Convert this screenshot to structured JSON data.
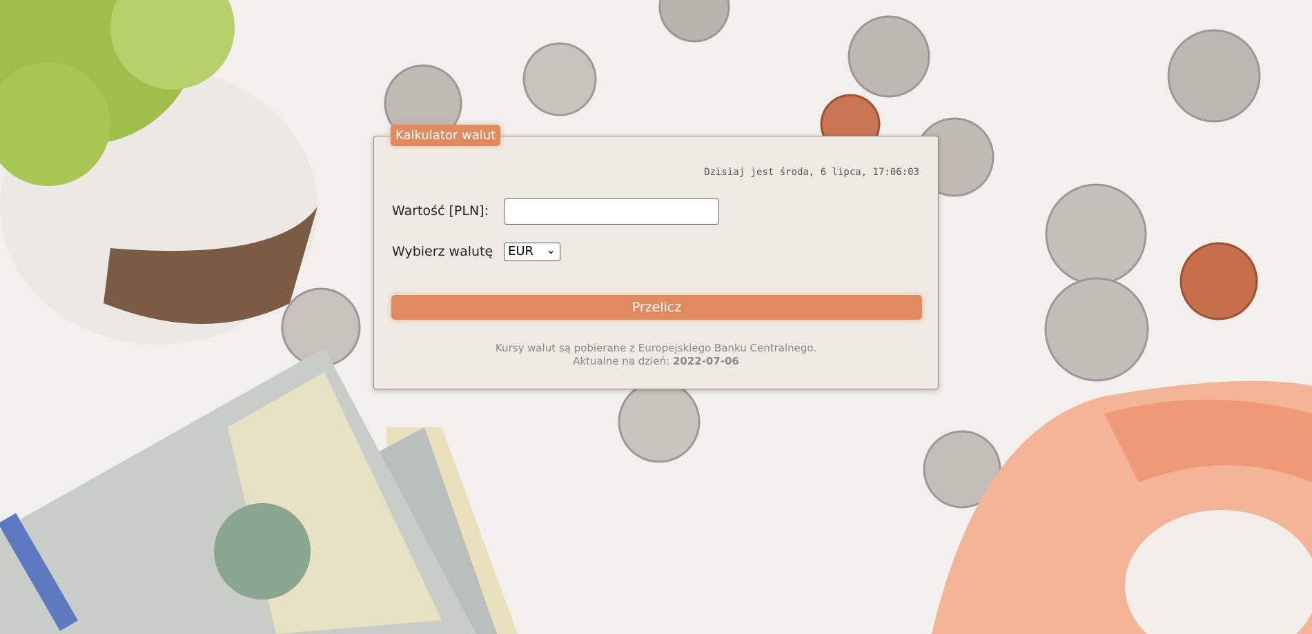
{
  "calculator": {
    "legend": "Kalkulator walut",
    "date_text": "Dzisiaj jest środa, 6 lipca, 17:06:03",
    "value_label": "Wartość [PLN]:",
    "value_input": "",
    "currency_label": "Wybierz walutę",
    "currency_selected": "EUR",
    "convert_button": "Przelicz",
    "info_line1": "Kursy walut są pobierane z Europejskiego Banku Centralnego.",
    "info_line2_prefix": "Aktualne na dzień:",
    "info_date": "2022-07-06"
  }
}
